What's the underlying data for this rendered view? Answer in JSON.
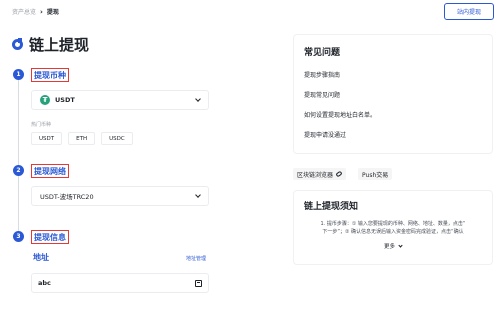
{
  "breadcrumb": {
    "home": "资产总览",
    "separator": "›",
    "current": "提现"
  },
  "header": {
    "station_button": "站内提现"
  },
  "page": {
    "title": "链上提现"
  },
  "steps": [
    {
      "num": "1",
      "label": "提现币种"
    },
    {
      "num": "2",
      "label": "提现网络"
    },
    {
      "num": "3",
      "label": "提现信息"
    }
  ],
  "coin_select": {
    "value": "USDT",
    "icon_glyph": "₮"
  },
  "hot_coins": {
    "label": "热门币种",
    "items": [
      "USDT",
      "ETH",
      "USDC"
    ]
  },
  "network_select": {
    "value": "USDT-波场TRC20"
  },
  "address": {
    "label": "地址",
    "manage_link": "地址管理",
    "value": "abc"
  },
  "faq": {
    "title": "常见问题",
    "items": [
      "提现步骤指南",
      "提现常见问题",
      "如何设置提现地址白名单。",
      "提现申请没通过"
    ]
  },
  "tools": {
    "explorer": "区块链浏览器",
    "push": "Push交易"
  },
  "notice": {
    "title": "链上提现须知",
    "line1": "1. 提币步骤：① 输入您要提现的币种、网络、地址、数量，点击“",
    "line2": "下一步”；② 确认信息无误后输入资金密码完成验证，点击“确认",
    "more": "更多"
  },
  "colors": {
    "accent": "#2b59d6",
    "step_highlight": "#e53935",
    "usdt": "#26a17b"
  }
}
